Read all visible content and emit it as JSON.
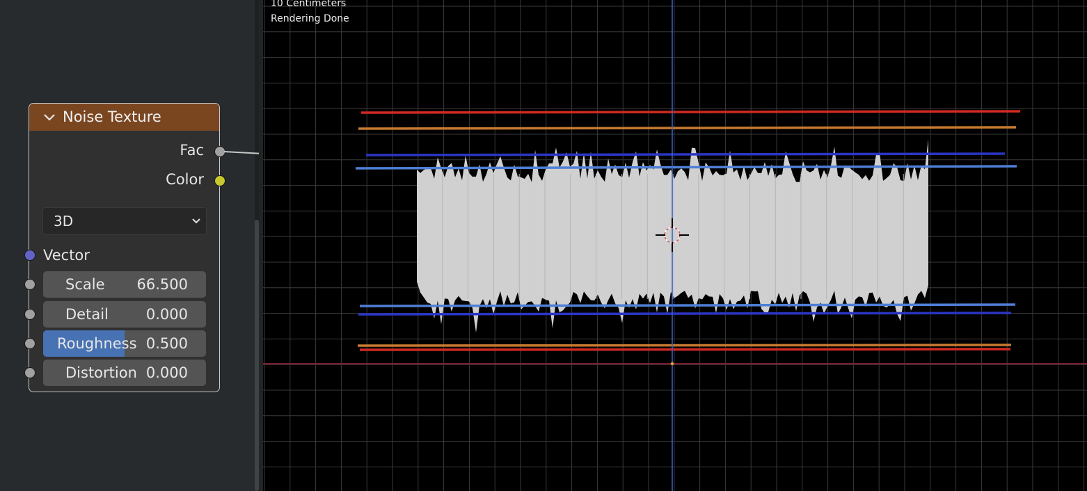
{
  "node": {
    "title": "Noise Texture",
    "collapse_icon": "chevron-down",
    "outputs": [
      {
        "label": "Fac",
        "socket_color": "#a1a1a1"
      },
      {
        "label": "Color",
        "socket_color": "#c7c72e"
      }
    ],
    "dimensions": "3D",
    "vector_label": "Vector",
    "fields": [
      {
        "label": "Scale",
        "value": "66.500",
        "fill_fraction": 0
      },
      {
        "label": "Detail",
        "value": "0.000",
        "fill_fraction": 0
      },
      {
        "label": "Roughness",
        "value": "0.500",
        "fill_fraction": 0.5
      },
      {
        "label": "Distortion",
        "value": "0.000",
        "fill_fraction": 0
      }
    ]
  },
  "viewport": {
    "scale_text": "10 Centimeters",
    "status_text": "Rendering Done",
    "line_colors": {
      "red": "#d12a22",
      "orange": "#c87a30",
      "dark_blue": "#2b35c4",
      "light_blue": "#4f7fd6",
      "x_axis": "#a3223e",
      "y_axis": "#3a63c7",
      "grid": "#3a3a3a",
      "mesh": "#d0d0d0"
    }
  }
}
